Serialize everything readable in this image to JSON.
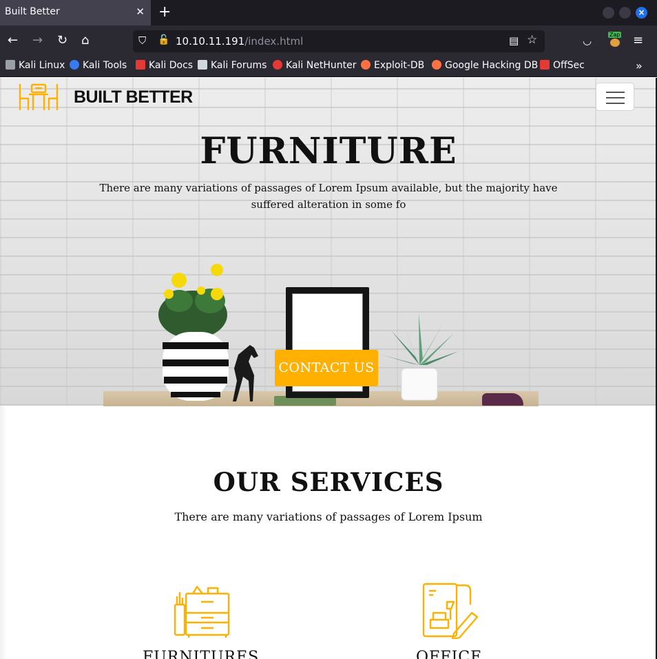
{
  "browser": {
    "tab_title": "Built Better",
    "tab_close": "✕",
    "new_tab": "+",
    "url_host": "10.10.11.191",
    "url_path": "/index.html",
    "zap_label": "Zap",
    "bookmarks": [
      {
        "label": "Kali Linux",
        "color": "#9aa0a6"
      },
      {
        "label": "Kali Tools",
        "color": "#367bf0"
      },
      {
        "label": "Kali Docs",
        "color": "#e53935"
      },
      {
        "label": "Kali Forums",
        "color": "#cfd8dc"
      },
      {
        "label": "Kali NetHunter",
        "color": "#e53935"
      },
      {
        "label": "Exploit-DB",
        "color": "#ff7043"
      },
      {
        "label": "Google Hacking DB",
        "color": "#ff7043"
      },
      {
        "label": "OffSec",
        "color": "#e53935"
      }
    ]
  },
  "site": {
    "brand": "BUILT BETTER",
    "accent": "#ffb000",
    "hero_title": "FURNITURE",
    "hero_text": "There are many variations of passages of Lorem Ipsum available, but the majority have suffered alteration in some fo",
    "contact_label": "CONTACT US",
    "services_title": "OUR SERVICES",
    "services_subtitle": "There are many variations of passages of Lorem Ipsum",
    "services": [
      {
        "label": "FURNITURES",
        "icon": "cabinet-icon"
      },
      {
        "label": "OFFICE",
        "icon": "office-plan-icon"
      }
    ]
  }
}
